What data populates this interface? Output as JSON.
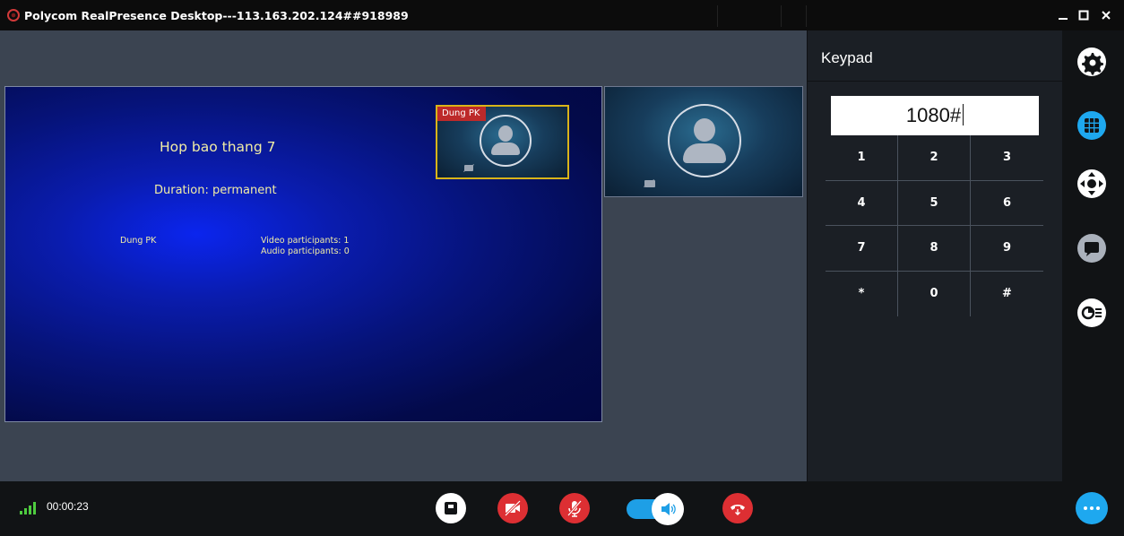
{
  "window": {
    "title": "Polycom RealPresence Desktop---113.163.202.124##918989",
    "controls": [
      "minimize-icon",
      "maximize-icon",
      "close-icon"
    ]
  },
  "conference_slide": {
    "title": "Hop bao thang 7",
    "duration": "Duration: permanent",
    "participant_name": "Dung PK",
    "video_participants": "Video participants: 1",
    "audio_participants": "Audio participants: 0"
  },
  "self_view": {
    "label": "Dung PK",
    "camera_status_icon": "camera-off-icon"
  },
  "remote_video": {
    "camera_status_icon": "camera-off-icon"
  },
  "keypad": {
    "title": "Keypad",
    "input_value": "1080#",
    "keys": [
      "1",
      "2",
      "3",
      "4",
      "5",
      "6",
      "7",
      "8",
      "9",
      "*",
      "0",
      "#"
    ]
  },
  "right_sidebar": {
    "items": [
      {
        "name": "settings",
        "icon": "gear-icon"
      },
      {
        "name": "keypad",
        "icon": "keypad-grid-icon",
        "active": true
      },
      {
        "name": "far-end-camera",
        "icon": "camera-control-icon"
      },
      {
        "name": "chat",
        "icon": "chat-icon"
      },
      {
        "name": "content-share",
        "icon": "content-list-icon"
      }
    ]
  },
  "bottom_bar": {
    "signal_icon": "signal-strength-icon",
    "call_duration": "00:00:23",
    "controls": [
      {
        "name": "self-view",
        "icon": "self-view-icon"
      },
      {
        "name": "video-mute",
        "icon": "camera-off-icon",
        "state": "muted"
      },
      {
        "name": "mic-mute",
        "icon": "microphone-off-icon",
        "state": "muted"
      },
      {
        "name": "speaker-volume",
        "icon": "speaker-icon",
        "state": "on"
      },
      {
        "name": "hang-up",
        "icon": "phone-hangup-icon"
      }
    ],
    "more_icon": "more-icon"
  },
  "colors": {
    "accent_blue": "#1ea8ef",
    "mute_red": "#dd2f33",
    "slide_text": "#f1eda5",
    "selected_border": "#d9b419",
    "signal_green": "#4ecb3f"
  }
}
